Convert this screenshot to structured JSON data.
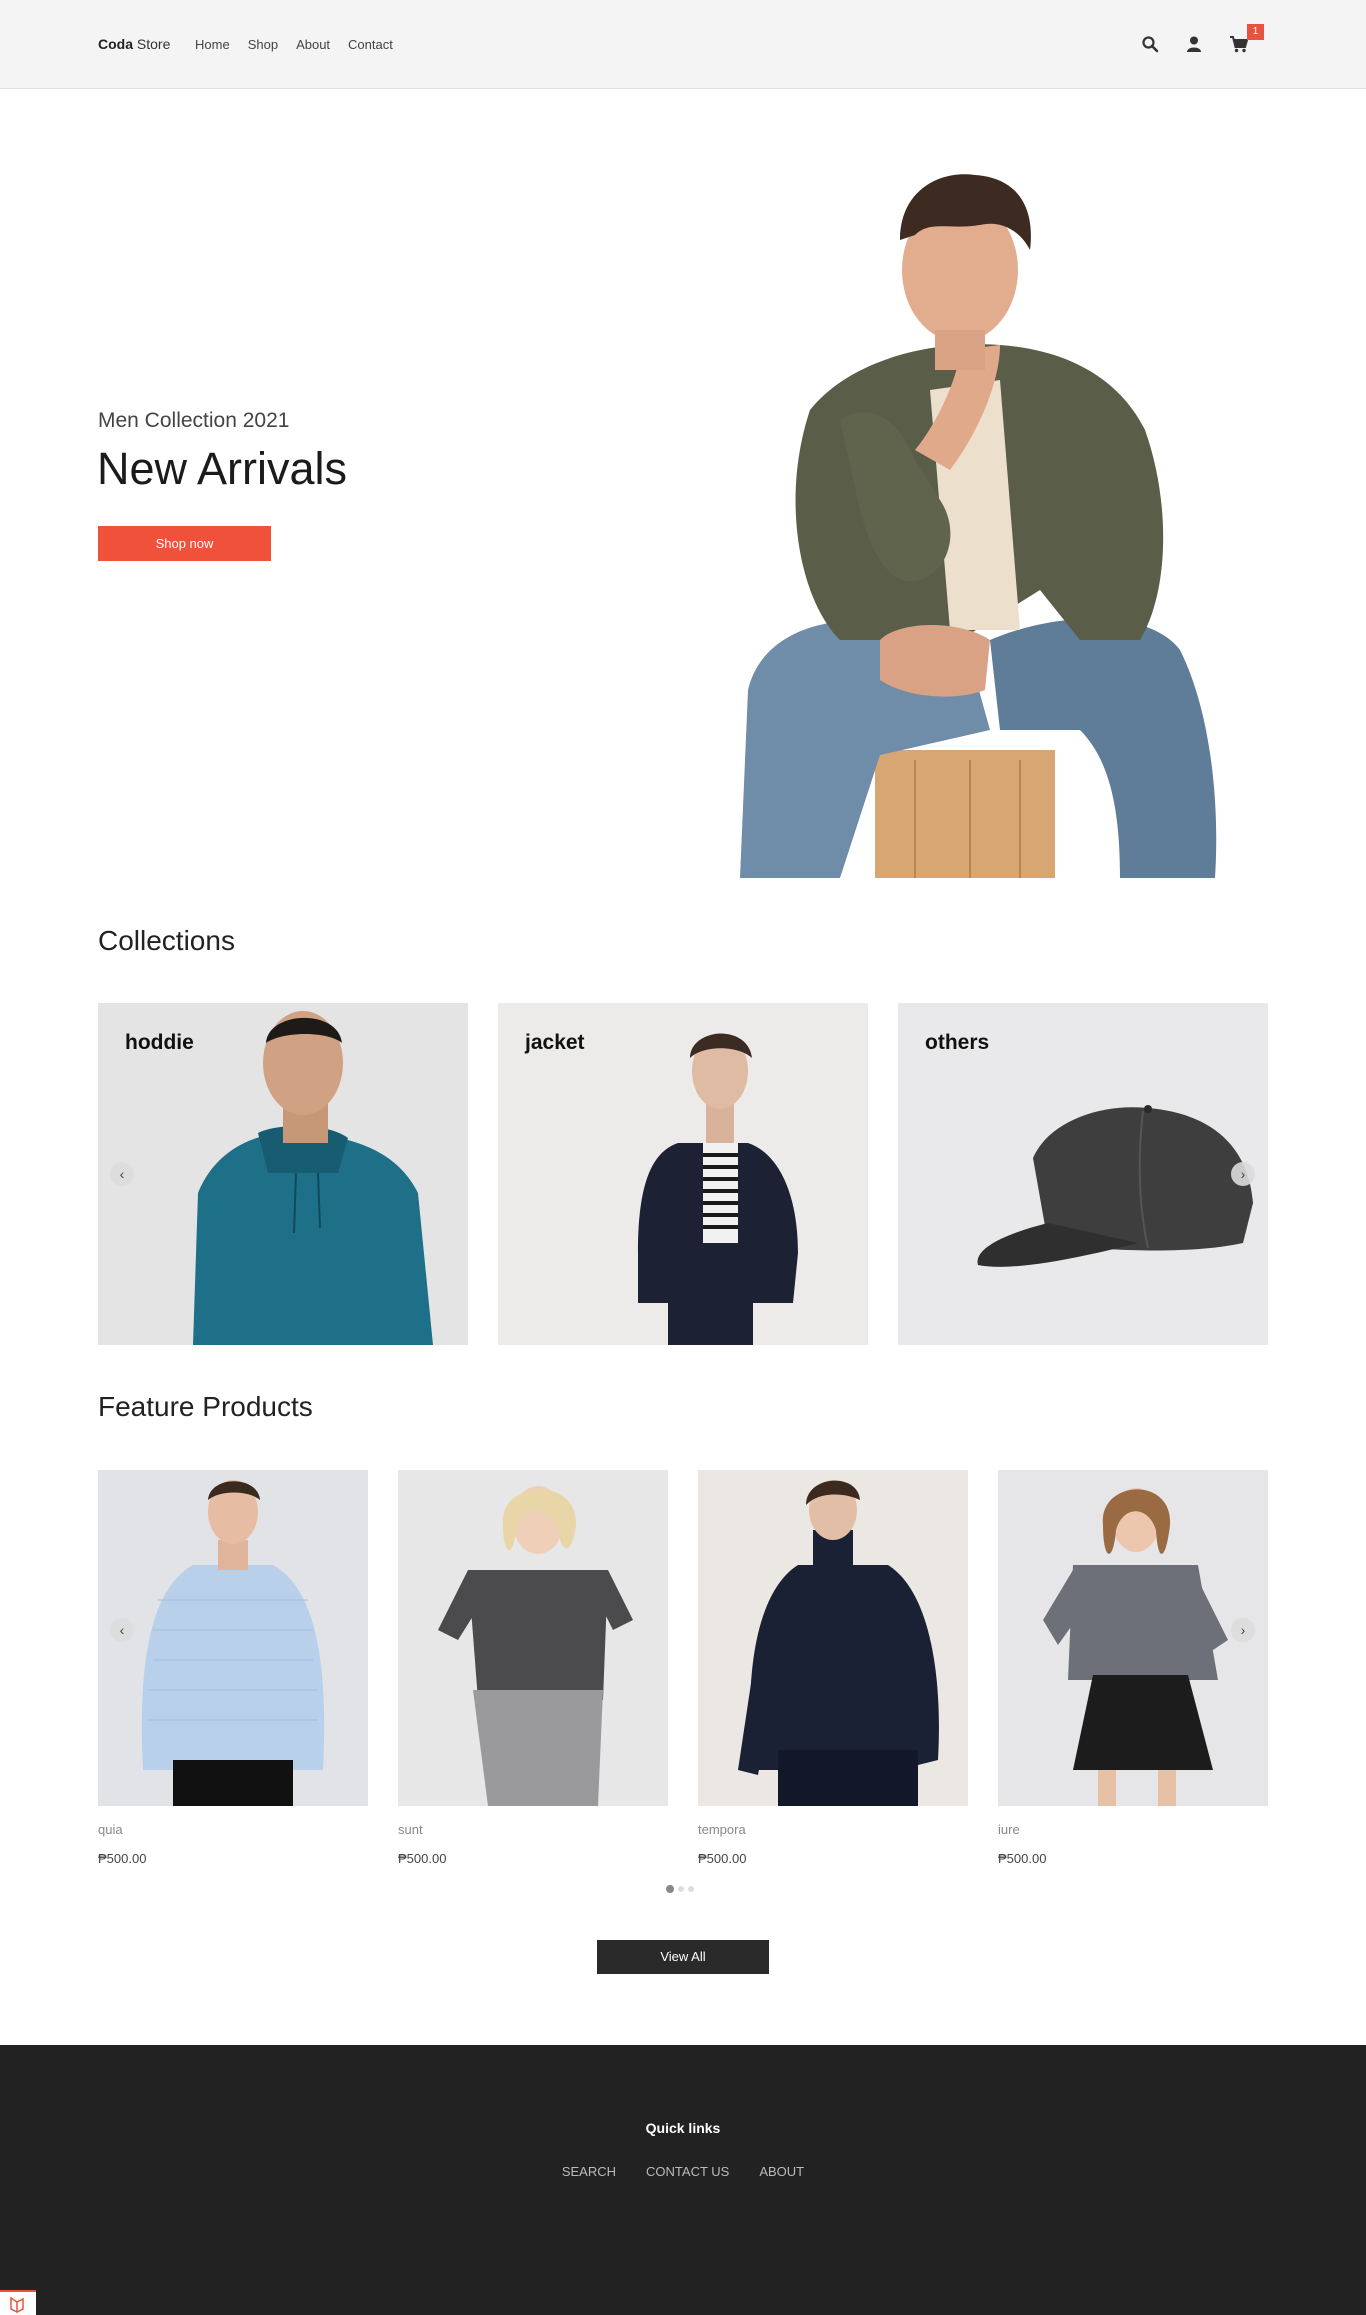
{
  "header": {
    "brand_bold": "Coda",
    "brand_rest": " Store",
    "nav": [
      "Home",
      "Shop",
      "About",
      "Contact"
    ],
    "cart_count": "1",
    "icons": [
      "search-icon",
      "user-icon",
      "cart-icon"
    ]
  },
  "hero": {
    "subtitle": "Men Collection 2021",
    "title": "New Arrivals",
    "button": "Shop now"
  },
  "collections": {
    "title": "Collections",
    "items": [
      "hoddie",
      "jacket",
      "others"
    ]
  },
  "featured": {
    "title": "Feature Products",
    "products": [
      {
        "name": "quia",
        "price": "₱500.00"
      },
      {
        "name": "sunt",
        "price": "₱500.00"
      },
      {
        "name": "tempora",
        "price": "₱500.00"
      },
      {
        "name": "iure",
        "price": "₱500.00"
      }
    ],
    "view_all": "View All"
  },
  "footer": {
    "title": "Quick links",
    "links": [
      "SEARCH",
      "CONTACT US",
      "ABOUT"
    ]
  },
  "colors": {
    "accent": "#f0513b",
    "dark": "#222222"
  }
}
